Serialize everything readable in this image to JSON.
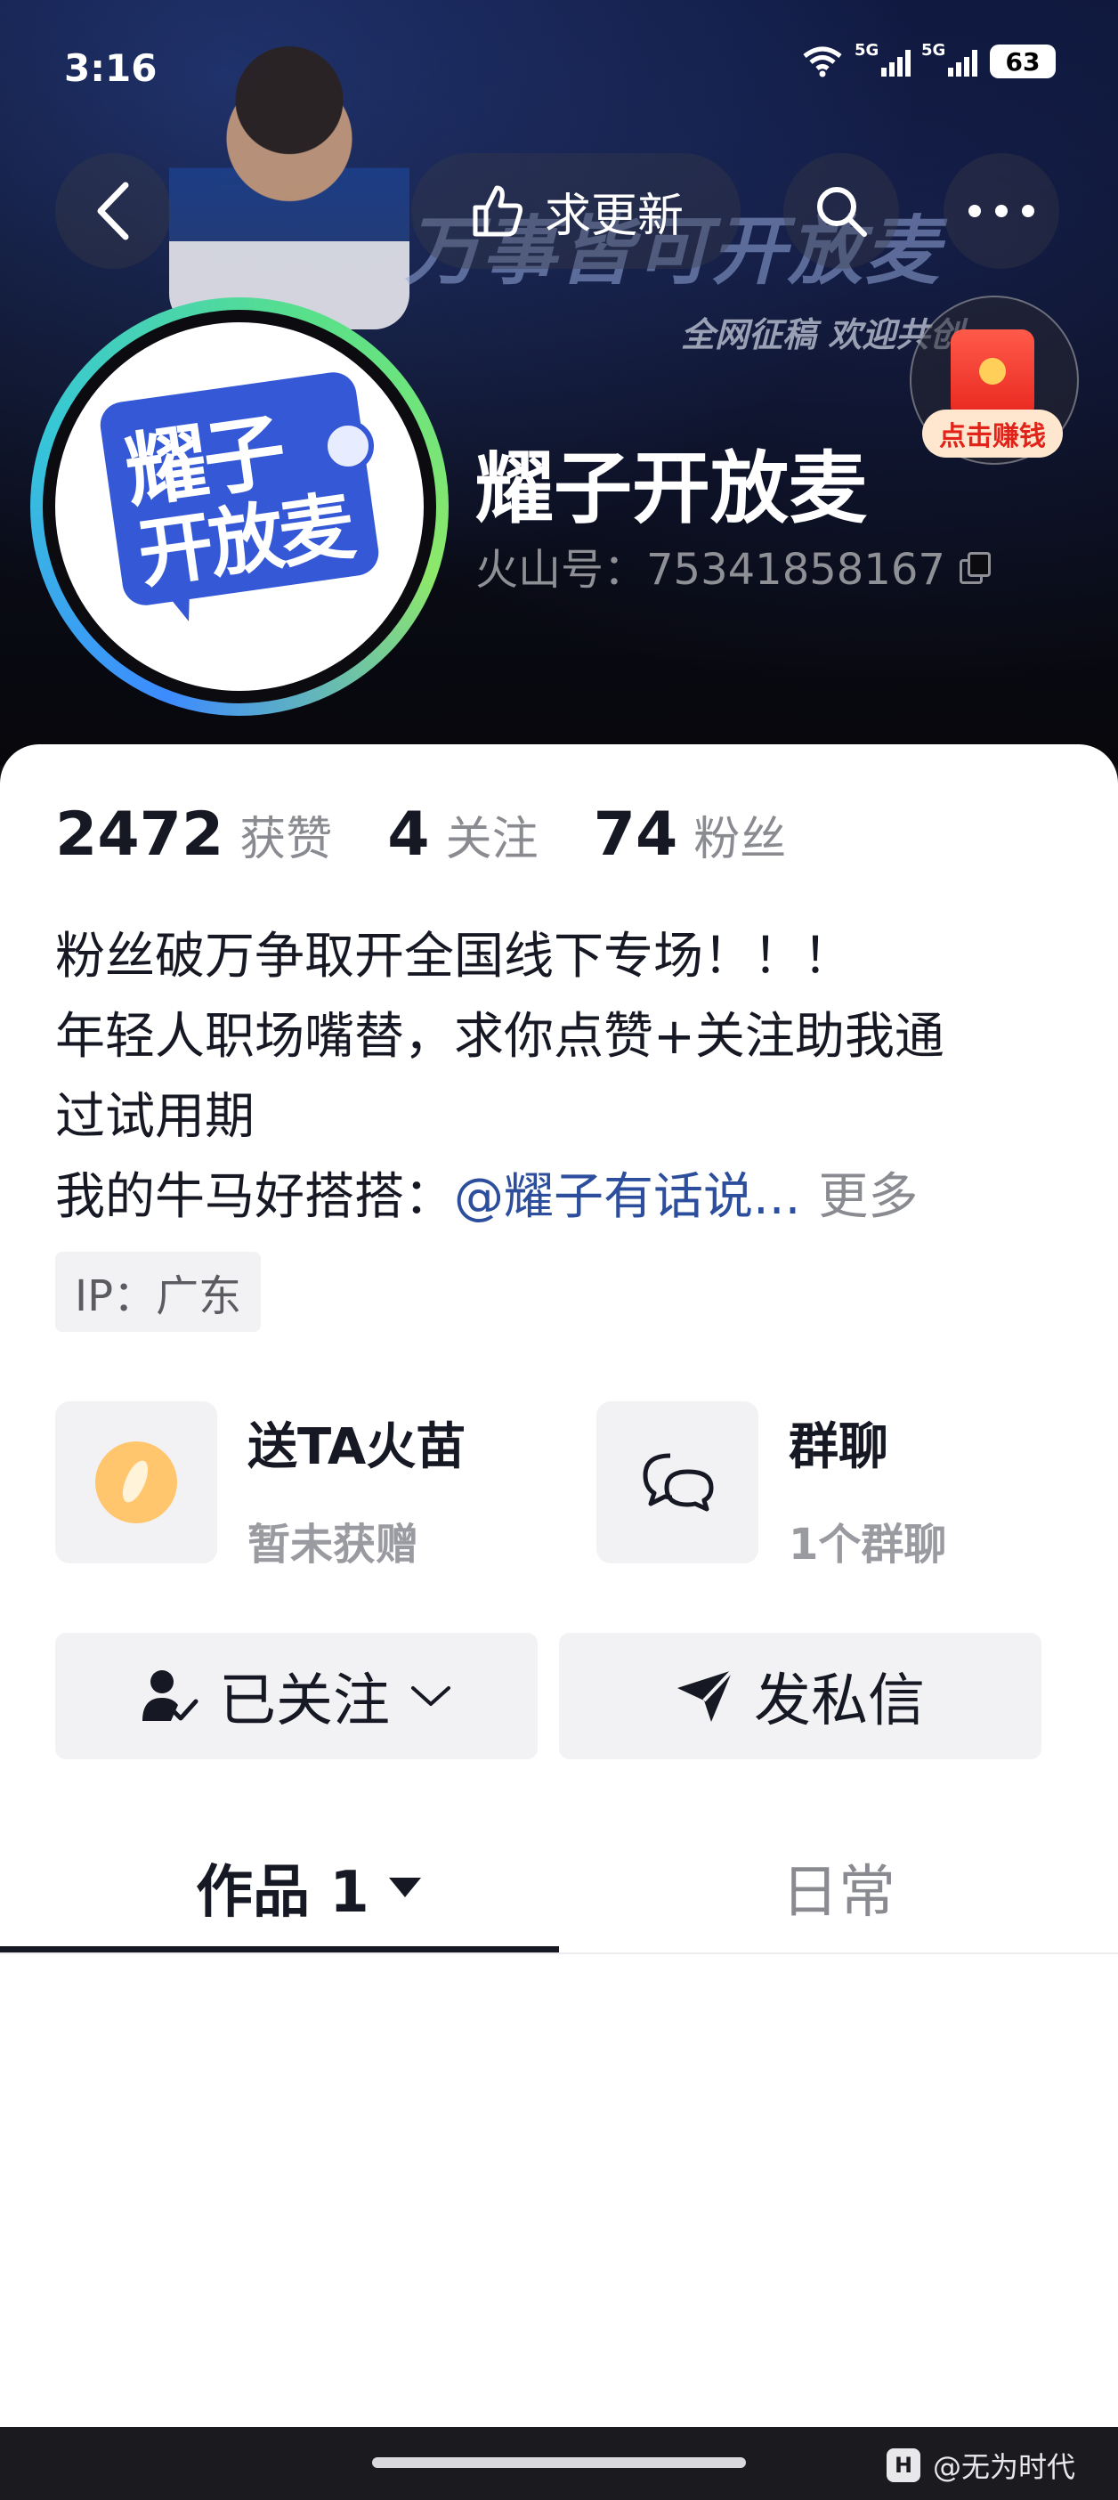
{
  "status_bar": {
    "time": "3:16",
    "net1": "5G",
    "net2": "5G",
    "battery": "63"
  },
  "nav": {
    "update_label": "求更新"
  },
  "banner": {
    "slogan": "万事皆可开放麦",
    "sub": "全网征稿 欢迎共创"
  },
  "red_packet": {
    "label": "点击赚钱"
  },
  "avatar": {
    "logo_line1": "耀子",
    "logo_line2": "开放麦"
  },
  "profile": {
    "name": "耀子开放麦",
    "account_id": "火山号：75341858167"
  },
  "stats": [
    {
      "value": "2472",
      "label": "获赞"
    },
    {
      "value": "4",
      "label": "关注"
    },
    {
      "value": "74",
      "label": "粉丝"
    }
  ],
  "bio": {
    "line1": "粉丝破万争取开全国线下专场！！！",
    "line2": "年轻人职场嘴替，求你点赞+关注助我通",
    "line3": "过试用期",
    "line4_prefix": "我的牛马好搭搭：",
    "line4_link": "@耀子有话说...",
    "more": "更多"
  },
  "ip": "IP：广东",
  "cards": {
    "fire": {
      "title": "送TA火苗",
      "sub": "暂未获赠"
    },
    "group": {
      "title": "群聊",
      "sub": "1个群聊"
    }
  },
  "actions": {
    "followed": "已关注",
    "message": "发私信"
  },
  "tabs": {
    "works": "作品 1",
    "daily": "日常"
  },
  "watermark": {
    "logo": "H",
    "text": "@无为时代"
  },
  "colors": {
    "accent_link": "#2c4e9c",
    "red_packet": "#e8271f",
    "avatar_ring_start": "#3d8bff",
    "avatar_ring_end": "#8de86a"
  }
}
